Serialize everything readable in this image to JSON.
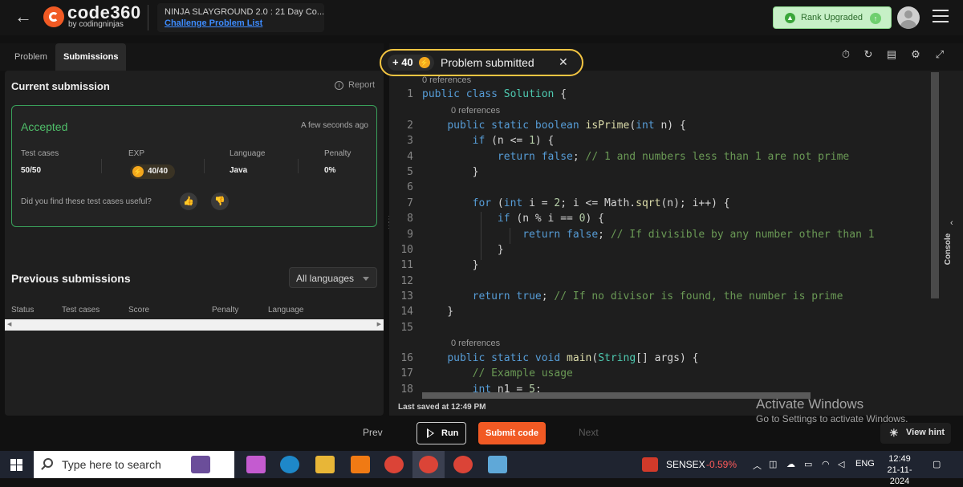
{
  "header": {
    "back_icon": "arrow-left-icon",
    "logo_text": "code360",
    "logo_sub": "by codingninjas",
    "challenge_title": "NINJA SLAYGROUND 2.0 : 21 Day Co...",
    "challenge_link": "Challenge Problem List",
    "rank_label": "Rank Upgraded"
  },
  "tabs": [
    "Problem",
    "Submissions"
  ],
  "current_submission": {
    "title": "Current submission",
    "report": "Report",
    "status": "Accepted",
    "time_ago": "A few seconds ago",
    "headers": [
      "Test cases",
      "EXP",
      "Language",
      "Penalty"
    ],
    "values": {
      "test_cases": "50/50",
      "exp": "40/40",
      "language": "Java",
      "penalty": "0%"
    },
    "feedback_question": "Did you find these test cases useful?"
  },
  "previous_submissions": {
    "title": "Previous submissions",
    "filter_value": "All languages",
    "columns": [
      "Status",
      "Test cases",
      "Score",
      "Penalty",
      "Language"
    ]
  },
  "toast": {
    "points": "+ 40",
    "message": "Problem submitted"
  },
  "editor": {
    "reference_label": "0 references",
    "last_saved": "Last saved at 12:49 PM",
    "console_label": "Console",
    "line_numbers": [
      "1",
      "2",
      "3",
      "4",
      "5",
      "6",
      "7",
      "8",
      "9",
      "10",
      "11",
      "12",
      "13",
      "14",
      "15",
      "16",
      "17",
      "18"
    ]
  },
  "footer": {
    "prev": "Prev",
    "run": "Run",
    "submit": "Submit code",
    "next": "Next",
    "view_hint": "View hint"
  },
  "watermark": {
    "line1": "Activate Windows",
    "line2": "Go to Settings to activate Windows."
  },
  "taskbar": {
    "search_placeholder": "Type here to search",
    "sensex_label": "SENSEX",
    "sensex_change": "-0.59%",
    "lang": "ENG",
    "time": "12:49",
    "date": "21-11-2024"
  },
  "colors": {
    "accent": "#f15a24",
    "accepted": "#4fbf6a",
    "toast_border": "#f4c542",
    "link": "#3d8bfd"
  }
}
